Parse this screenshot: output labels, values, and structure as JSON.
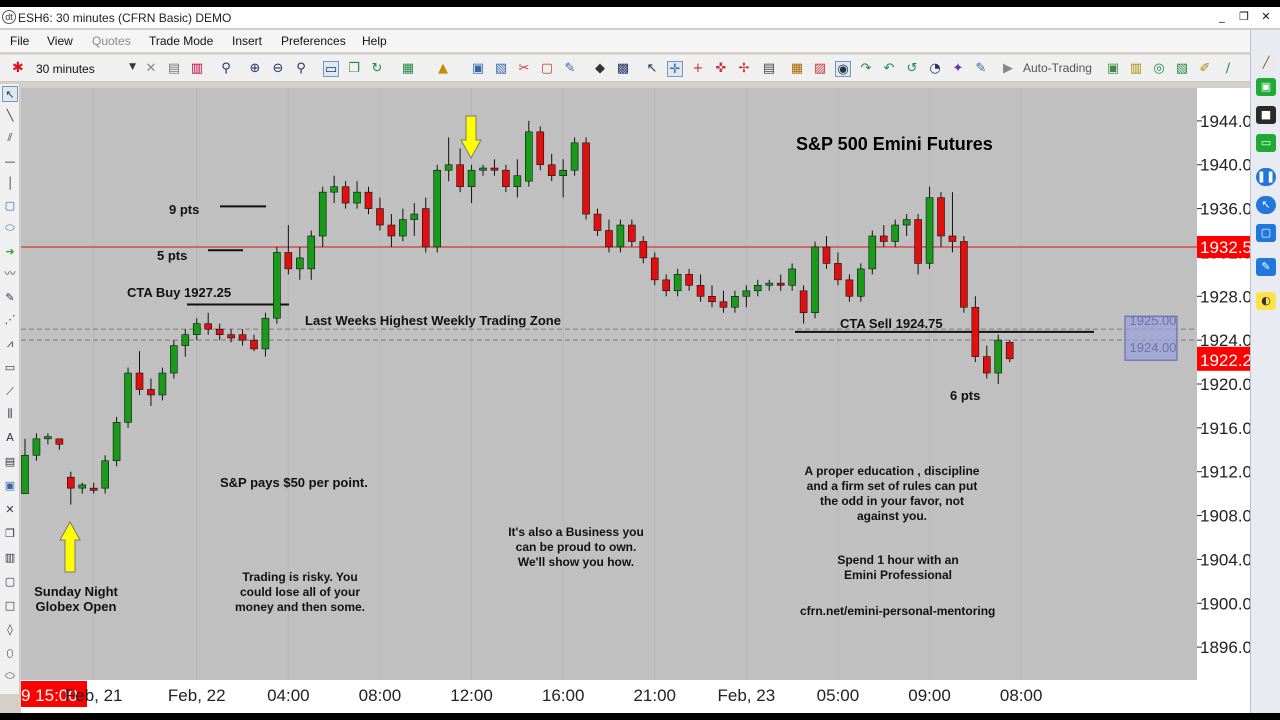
{
  "window": {
    "title": "ESH6: 30 minutes (CFRN Basic) DEMO",
    "app_icon_glyph": "dt",
    "controls": [
      "_",
      "❐",
      "✕"
    ]
  },
  "menu": [
    "File",
    "View",
    "Quotes",
    "Trade Mode",
    "Insert",
    "Preferences",
    "Help"
  ],
  "toolbar": {
    "interval": "30 minutes",
    "auto_trading_label": "Auto-Trading"
  },
  "chart": {
    "title": "S&P 500 Emini Futures",
    "current_price_label": "1922.25",
    "red_line_label": "1932.5",
    "zone_top_label": "1925.00",
    "zone_bottom_label": "1924.00",
    "annotations": {
      "pts9": "9 pts",
      "pts5": "5 pts",
      "pts6": "6 pts",
      "cta_buy": "CTA Buy 1927.25",
      "cta_sell": "CTA Sell 1924.75",
      "weekly_zone": "Last Weeks Highest Weekly Trading Zone",
      "sunday": "Sunday Night\nGlobex Open",
      "pays": "S&P pays $50 per point.",
      "risky": "Trading is risky. You\ncould lose all of your\nmoney and then some.",
      "business": "It's also a Business you\ncan be proud to own.\nWe'll show you how.",
      "education": "A proper education , discipline\nand a firm set of rules can put\nthe odd in your favor, not\nagainst you.",
      "spend": "Spend 1 hour with an\nEmini Professional",
      "url": "cfrn.net/emini-personal-mentoring"
    },
    "colors": {
      "background": "#c0c0c0",
      "up": "#1a9a1a",
      "down": "#e01010",
      "price_box": "#ff0000",
      "time_highlight": "#ff0000"
    }
  },
  "chart_data": {
    "type": "candlestick",
    "symbol": "ESH6",
    "interval": "30 minutes",
    "y_ticks": [
      "1944.00",
      "1940.00",
      "1936.00",
      "1932.00",
      "1928.00",
      "1924.00",
      "1920.00",
      "1916.00",
      "1912.00",
      "1908.00",
      "1904.00",
      "1900.00",
      "1896.00"
    ],
    "y_tick_values": [
      1944,
      1940,
      1936,
      1932,
      1928,
      1924,
      1920,
      1916,
      1912,
      1908,
      1904,
      1900,
      1896
    ],
    "x_ticks": [
      "Feb, 21",
      "Feb, 22",
      "04:00",
      "08:00",
      "12:00",
      "16:00",
      "21:00",
      "Feb, 23",
      "05:00",
      "09:00",
      "08:00"
    ],
    "x_tick_bar_index": [
      6,
      15,
      23,
      31,
      39,
      47,
      55,
      63,
      71,
      79,
      87
    ],
    "highlighted_time": "9 15:00",
    "ylim": [
      1893,
      1947
    ],
    "horizontal_lines": {
      "red_line": 1932.5,
      "zone_top": 1925,
      "zone_bottom": 1924,
      "cta_buy": 1927.25,
      "cta_sell": 1924.75,
      "nine_pts": 1936.2,
      "five_pts": 1932.2
    },
    "candles": [
      [
        1910.0,
        1915.0,
        1910.0,
        1913.5
      ],
      [
        1913.5,
        1915.5,
        1913.0,
        1915.0
      ],
      [
        1915.0,
        1915.5,
        1914.5,
        1915.2
      ],
      [
        1915.0,
        1915.0,
        1914.0,
        1914.5
      ],
      [
        1911.5,
        1912.0,
        1909.0,
        1910.5
      ],
      [
        1910.5,
        1911.0,
        1910.0,
        1910.8
      ],
      [
        1910.5,
        1911.0,
        1910.0,
        1910.3
      ],
      [
        1910.5,
        1913.5,
        1910.0,
        1913.0
      ],
      [
        1913.0,
        1917.0,
        1912.5,
        1916.5
      ],
      [
        1916.5,
        1921.5,
        1916.0,
        1921.0
      ],
      [
        1921.0,
        1923.0,
        1919.0,
        1919.5
      ],
      [
        1919.5,
        1920.5,
        1918.0,
        1919.0
      ],
      [
        1919.0,
        1921.5,
        1918.5,
        1921.0
      ],
      [
        1921.0,
        1924.0,
        1920.5,
        1923.5
      ],
      [
        1923.5,
        1925.0,
        1922.5,
        1924.5
      ],
      [
        1924.5,
        1926.0,
        1924.0,
        1925.5
      ],
      [
        1925.5,
        1926.5,
        1924.5,
        1925.0
      ],
      [
        1925.0,
        1925.5,
        1924.0,
        1924.5
      ],
      [
        1924.5,
        1925.0,
        1923.8,
        1924.2
      ],
      [
        1924.5,
        1925.0,
        1923.5,
        1924.0
      ],
      [
        1924.0,
        1924.5,
        1923.0,
        1923.2
      ],
      [
        1923.2,
        1926.5,
        1922.5,
        1926.0
      ],
      [
        1926.0,
        1932.5,
        1925.5,
        1932.0
      ],
      [
        1932.0,
        1934.5,
        1930.0,
        1930.5
      ],
      [
        1930.5,
        1932.5,
        1929.5,
        1931.5
      ],
      [
        1930.5,
        1934.0,
        1929.5,
        1933.5
      ],
      [
        1933.5,
        1938.0,
        1932.5,
        1937.5
      ],
      [
        1937.5,
        1939.0,
        1936.5,
        1938.0
      ],
      [
        1938.0,
        1938.5,
        1936.0,
        1936.5
      ],
      [
        1936.5,
        1938.5,
        1936.0,
        1937.5
      ],
      [
        1937.5,
        1938.0,
        1935.5,
        1936.0
      ],
      [
        1936.0,
        1937.0,
        1934.0,
        1934.5
      ],
      [
        1934.5,
        1935.5,
        1932.5,
        1933.5
      ],
      [
        1933.5,
        1936.0,
        1933.0,
        1935.0
      ],
      [
        1935.0,
        1936.5,
        1933.5,
        1935.5
      ],
      [
        1936.0,
        1937.0,
        1932.0,
        1932.5
      ],
      [
        1932.5,
        1940.0,
        1932.0,
        1939.5
      ],
      [
        1939.5,
        1942.5,
        1938.5,
        1940.0
      ],
      [
        1940.0,
        1941.5,
        1937.5,
        1938.0
      ],
      [
        1938.0,
        1940.0,
        1936.5,
        1939.5
      ],
      [
        1939.5,
        1940.0,
        1939.0,
        1939.7
      ],
      [
        1939.7,
        1940.5,
        1939.0,
        1939.5
      ],
      [
        1939.5,
        1940.0,
        1937.5,
        1938.0
      ],
      [
        1938.0,
        1940.5,
        1937.0,
        1939.0
      ],
      [
        1938.5,
        1944.0,
        1938.0,
        1943.0
      ],
      [
        1943.0,
        1943.5,
        1939.5,
        1940.0
      ],
      [
        1940.0,
        1941.0,
        1938.5,
        1939.0
      ],
      [
        1939.0,
        1940.5,
        1937.0,
        1939.5
      ],
      [
        1939.5,
        1942.5,
        1939.0,
        1942.0
      ],
      [
        1942.0,
        1942.5,
        1935.0,
        1935.5
      ],
      [
        1935.5,
        1936.0,
        1933.5,
        1934.0
      ],
      [
        1934.0,
        1935.0,
        1932.0,
        1932.5
      ],
      [
        1932.5,
        1935.0,
        1932.0,
        1934.5
      ],
      [
        1934.5,
        1935.0,
        1932.5,
        1933.0
      ],
      [
        1933.0,
        1933.5,
        1931.0,
        1931.5
      ],
      [
        1931.5,
        1932.0,
        1929.0,
        1929.5
      ],
      [
        1929.5,
        1930.0,
        1928.0,
        1928.5
      ],
      [
        1928.5,
        1930.5,
        1928.0,
        1930.0
      ],
      [
        1930.0,
        1930.5,
        1928.5,
        1929.0
      ],
      [
        1929.0,
        1930.0,
        1927.5,
        1928.0
      ],
      [
        1928.0,
        1929.0,
        1927.0,
        1927.5
      ],
      [
        1927.5,
        1928.5,
        1926.5,
        1927.0
      ],
      [
        1927.0,
        1928.5,
        1926.5,
        1928.0
      ],
      [
        1928.0,
        1929.0,
        1927.0,
        1928.5
      ],
      [
        1928.5,
        1929.5,
        1928.0,
        1929.0
      ],
      [
        1929.0,
        1929.5,
        1928.5,
        1929.2
      ],
      [
        1929.2,
        1930.0,
        1928.5,
        1929.0
      ],
      [
        1929.0,
        1931.0,
        1928.5,
        1930.5
      ],
      [
        1928.5,
        1929.0,
        1925.5,
        1926.5
      ],
      [
        1926.5,
        1933.0,
        1926.0,
        1932.5
      ],
      [
        1932.5,
        1933.5,
        1930.5,
        1931.0
      ],
      [
        1931.0,
        1932.0,
        1929.0,
        1929.5
      ],
      [
        1929.5,
        1930.0,
        1927.5,
        1928.0
      ],
      [
        1928.0,
        1931.0,
        1927.5,
        1930.5
      ],
      [
        1930.5,
        1934.0,
        1930.0,
        1933.5
      ],
      [
        1933.5,
        1934.5,
        1932.5,
        1933.0
      ],
      [
        1933.0,
        1935.0,
        1932.5,
        1934.5
      ],
      [
        1934.5,
        1935.5,
        1933.5,
        1935.0
      ],
      [
        1935.0,
        1935.5,
        1930.0,
        1931.0
      ],
      [
        1931.0,
        1938.0,
        1930.5,
        1937.0
      ],
      [
        1937.0,
        1937.5,
        1932.5,
        1933.5
      ],
      [
        1933.5,
        1937.5,
        1932.0,
        1933.0
      ],
      [
        1933.0,
        1933.5,
        1926.5,
        1927.0
      ],
      [
        1927.0,
        1928.0,
        1922.0,
        1922.5
      ],
      [
        1922.5,
        1923.5,
        1920.5,
        1921.0
      ],
      [
        1921.0,
        1924.5,
        1920.0,
        1924.0
      ],
      [
        1923.8,
        1924.0,
        1922.0,
        1922.3
      ]
    ]
  }
}
